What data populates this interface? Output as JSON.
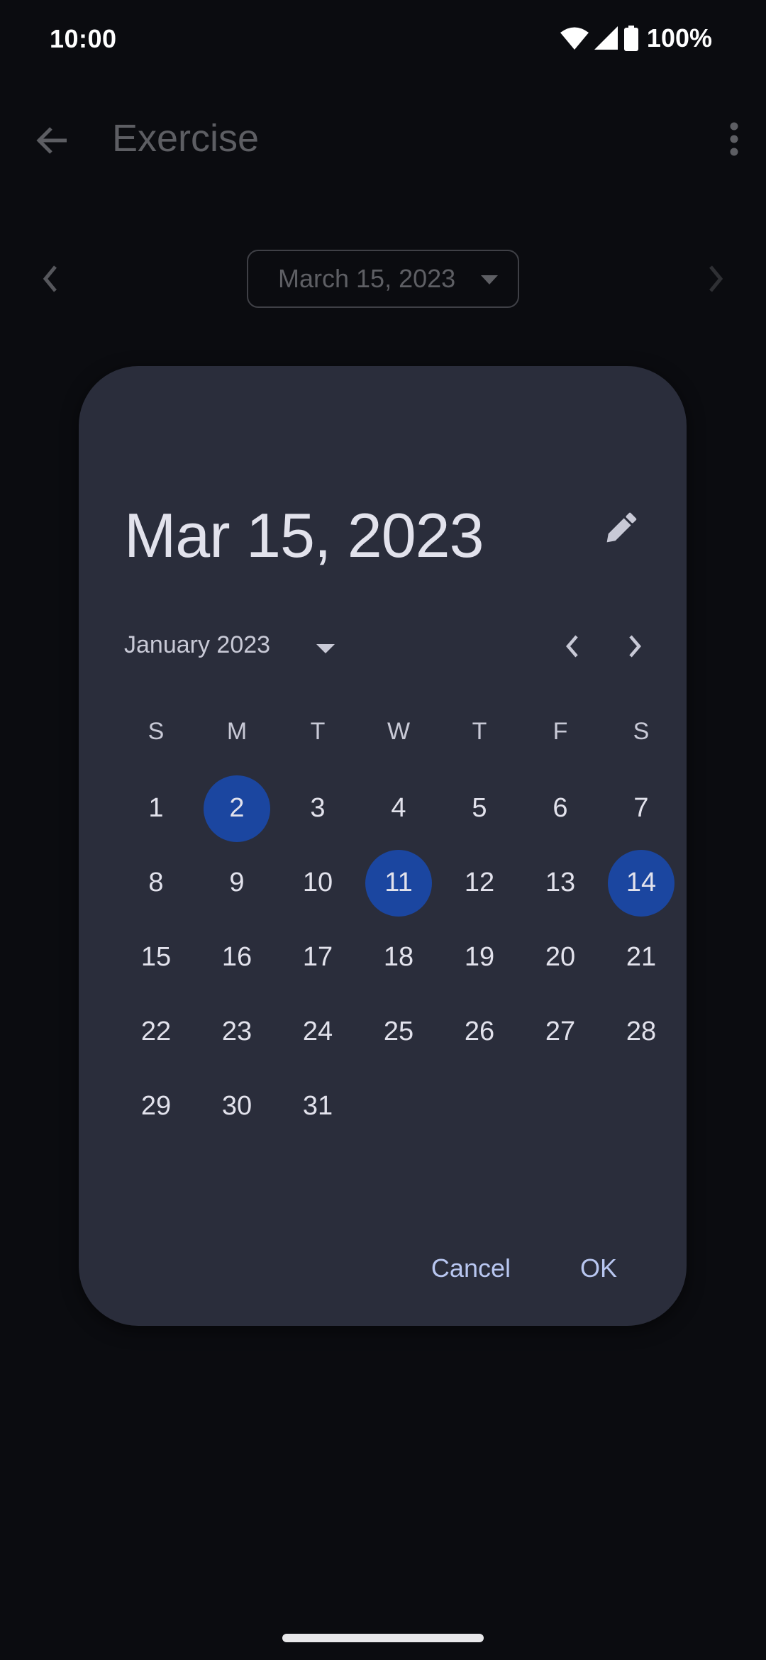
{
  "status_bar": {
    "time": "10:00",
    "battery": "100%",
    "icons": [
      "wifi-icon",
      "cellular-signal-icon",
      "battery-icon"
    ]
  },
  "app_bar": {
    "title": "Exercise",
    "back_icon": "arrow-left-icon",
    "menu_icon": "more-vert-icon"
  },
  "date_nav": {
    "selected_date": "March 15, 2023",
    "prev_icon": "chevron-left-icon",
    "next_icon": "chevron-right-icon"
  },
  "dialog": {
    "headline": "Mar 15, 2023",
    "edit_icon": "pencil-icon",
    "month_label": "January 2023",
    "weekdays": [
      "S",
      "M",
      "T",
      "W",
      "T",
      "F",
      "S"
    ],
    "first_weekday_offset": 0,
    "days_in_month": 31,
    "highlighted_days": [
      2,
      11,
      14
    ],
    "highlight_color": "#1b46a0",
    "actions": {
      "cancel": "Cancel",
      "ok": "OK"
    }
  },
  "colors": {
    "background": "#0b0c10",
    "dialog_surface": "#2a2d3b",
    "accent_text": "#b8c6f0"
  }
}
